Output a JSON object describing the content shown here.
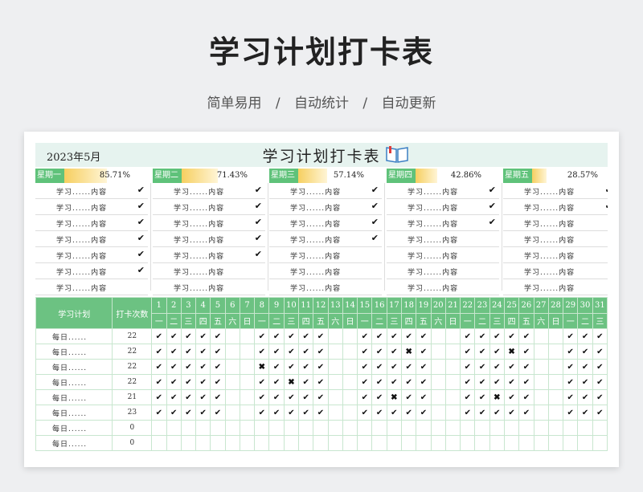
{
  "hero": {
    "title": "学习计划打卡表",
    "features": [
      "简单易用",
      "/",
      "自动统计",
      "/",
      "自动更新"
    ]
  },
  "sheet": {
    "month": "2023年5月",
    "title": "学习计划打卡表",
    "title_icon": "open-book-icon",
    "weeks": [
      {
        "label": "星期一",
        "percent": "85.71%",
        "fraction": 0.8571,
        "tasks": [
          {
            "text": "学习......内容",
            "check": "✔"
          },
          {
            "text": "学习......内容",
            "check": "✔"
          },
          {
            "text": "学习......内容",
            "check": "✔"
          },
          {
            "text": "学习......内容",
            "check": "✔"
          },
          {
            "text": "学习......内容",
            "check": "✔"
          },
          {
            "text": "学习......内容",
            "check": "✔"
          },
          {
            "text": "学习......内容",
            "check": ""
          }
        ]
      },
      {
        "label": "星期二",
        "percent": "71.43%",
        "fraction": 0.7143,
        "tasks": [
          {
            "text": "学习......内容",
            "check": "✔"
          },
          {
            "text": "学习......内容",
            "check": "✔"
          },
          {
            "text": "学习......内容",
            "check": "✔"
          },
          {
            "text": "学习......内容",
            "check": "✔"
          },
          {
            "text": "学习......内容",
            "check": "✔"
          },
          {
            "text": "学习......内容",
            "check": ""
          },
          {
            "text": "学习......内容",
            "check": ""
          }
        ]
      },
      {
        "label": "星期三",
        "percent": "57.14%",
        "fraction": 0.5714,
        "tasks": [
          {
            "text": "学习......内容",
            "check": "✔"
          },
          {
            "text": "学习......内容",
            "check": "✔"
          },
          {
            "text": "学习......内容",
            "check": "✔"
          },
          {
            "text": "学习......内容",
            "check": "✔"
          },
          {
            "text": "学习......内容",
            "check": ""
          },
          {
            "text": "学习......内容",
            "check": ""
          },
          {
            "text": "学习......内容",
            "check": ""
          }
        ]
      },
      {
        "label": "星期四",
        "percent": "42.86%",
        "fraction": 0.4286,
        "tasks": [
          {
            "text": "学习......内容",
            "check": "✔"
          },
          {
            "text": "学习......内容",
            "check": "✔"
          },
          {
            "text": "学习......内容",
            "check": "✔"
          },
          {
            "text": "学习......内容",
            "check": ""
          },
          {
            "text": "学习......内容",
            "check": ""
          },
          {
            "text": "学习......内容",
            "check": ""
          },
          {
            "text": "学习......内容",
            "check": ""
          }
        ]
      },
      {
        "label": "星期五",
        "percent": "28.57%",
        "fraction": 0.2857,
        "tasks": [
          {
            "text": "学习......内容",
            "check": "✔"
          },
          {
            "text": "学习......内容",
            "check": "✔"
          },
          {
            "text": "学习......内容",
            "check": ""
          },
          {
            "text": "学习......内容",
            "check": ""
          },
          {
            "text": "学习......内容",
            "check": ""
          },
          {
            "text": "学习......内容",
            "check": ""
          },
          {
            "text": "学习......内容",
            "check": ""
          }
        ]
      }
    ],
    "grid": {
      "plan_header": "学习计划",
      "count_header": "打卡次数",
      "days": [
        "1",
        "2",
        "3",
        "4",
        "5",
        "6",
        "7",
        "8",
        "9",
        "10",
        "11",
        "12",
        "13",
        "14",
        "15",
        "16",
        "17",
        "18",
        "19",
        "20",
        "21",
        "22",
        "23",
        "24",
        "25",
        "26",
        "27",
        "28",
        "29",
        "30",
        "31"
      ],
      "weekdays": [
        "一",
        "二",
        "三",
        "四",
        "五",
        "六",
        "日",
        "一",
        "二",
        "三",
        "四",
        "五",
        "六",
        "日",
        "一",
        "二",
        "三",
        "四",
        "五",
        "六",
        "日",
        "一",
        "二",
        "三",
        "四",
        "五",
        "六",
        "日",
        "一",
        "二",
        "三"
      ],
      "rows": [
        {
          "plan": "每日......",
          "count": "22",
          "marks": [
            "✔",
            "✔",
            "✔",
            "✔",
            "✔",
            "",
            "",
            "✔",
            "✔",
            "✔",
            "✔",
            "✔",
            "",
            "",
            "✔",
            "✔",
            "✔",
            "✔",
            "✔",
            "",
            "",
            "✔",
            "✔",
            "✔",
            "✔",
            "✔",
            "",
            "",
            "✔",
            "✔",
            "✔"
          ]
        },
        {
          "plan": "每日......",
          "count": "22",
          "marks": [
            "✔",
            "✔",
            "✔",
            "✔",
            "✔",
            "",
            "",
            "✔",
            "✔",
            "✔",
            "✔",
            "✔",
            "",
            "",
            "✔",
            "✔",
            "✔",
            "✖",
            "✔",
            "",
            "",
            "✔",
            "✔",
            "✔",
            "✖",
            "✔",
            "",
            "",
            "✔",
            "✔",
            "✔"
          ]
        },
        {
          "plan": "每日......",
          "count": "22",
          "marks": [
            "✔",
            "✔",
            "✔",
            "✔",
            "✔",
            "",
            "",
            "✖",
            "✔",
            "✔",
            "✔",
            "✔",
            "",
            "",
            "✔",
            "✔",
            "✔",
            "✔",
            "✔",
            "",
            "",
            "✔",
            "✔",
            "✔",
            "✔",
            "✔",
            "",
            "",
            "✔",
            "✔",
            "✔"
          ]
        },
        {
          "plan": "每日......",
          "count": "22",
          "marks": [
            "✔",
            "✔",
            "✔",
            "✔",
            "✔",
            "",
            "",
            "✔",
            "✔",
            "✖",
            "✔",
            "✔",
            "",
            "",
            "✔",
            "✔",
            "✔",
            "✔",
            "✔",
            "",
            "",
            "✔",
            "✔",
            "✔",
            "✔",
            "✔",
            "",
            "",
            "✔",
            "✔",
            "✔"
          ]
        },
        {
          "plan": "每日......",
          "count": "21",
          "marks": [
            "✔",
            "✔",
            "✔",
            "✔",
            "✔",
            "",
            "",
            "✔",
            "✔",
            "✔",
            "✔",
            "✔",
            "",
            "",
            "✔",
            "✔",
            "✖",
            "✔",
            "✔",
            "",
            "",
            "✔",
            "✔",
            "✖",
            "✔",
            "✔",
            "",
            "",
            "✔",
            "✔",
            "✔"
          ]
        },
        {
          "plan": "每日......",
          "count": "23",
          "marks": [
            "✔",
            "✔",
            "✔",
            "✔",
            "✔",
            "",
            "",
            "✔",
            "✔",
            "✔",
            "✔",
            "✔",
            "",
            "",
            "✔",
            "✔",
            "✔",
            "✔",
            "✔",
            "",
            "",
            "✔",
            "✔",
            "✔",
            "✔",
            "✔",
            "",
            "",
            "✔",
            "✔",
            "✔"
          ]
        },
        {
          "plan": "每日......",
          "count": "0",
          "marks": [
            "",
            "",
            "",
            "",
            "",
            "",
            "",
            "",
            "",
            "",
            "",
            "",
            "",
            "",
            "",
            "",
            "",
            "",
            "",
            "",
            "",
            "",
            "",
            "",
            "",
            "",
            "",
            "",
            "",
            "",
            ""
          ]
        },
        {
          "plan": "每日......",
          "count": "0",
          "marks": [
            "",
            "",
            "",
            "",
            "",
            "",
            "",
            "",
            "",
            "",
            "",
            "",
            "",
            "",
            "",
            "",
            "",
            "",
            "",
            "",
            "",
            "",
            "",
            "",
            "",
            "",
            "",
            "",
            "",
            "",
            ""
          ]
        }
      ]
    }
  }
}
